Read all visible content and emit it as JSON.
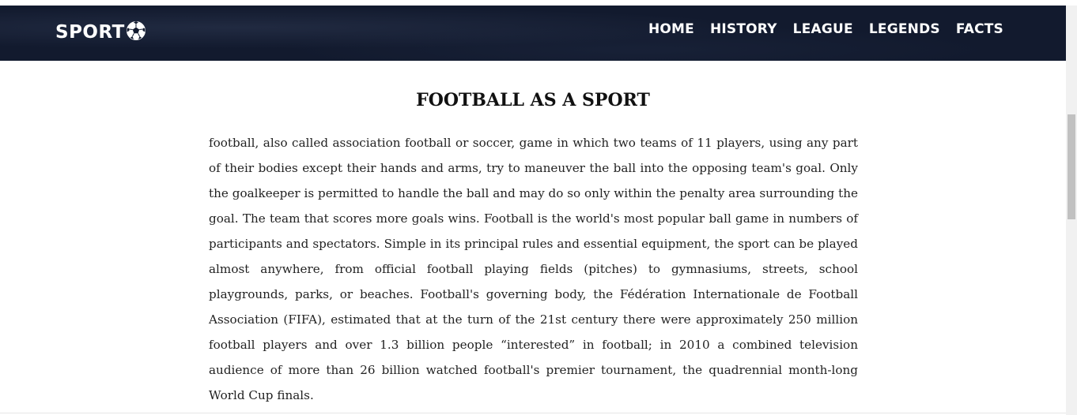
{
  "header": {
    "logo_text": "SPORT",
    "logo_icon": "soccer-ball-icon",
    "background_color": "#121a2e"
  },
  "nav": {
    "items": [
      {
        "label": "HOME"
      },
      {
        "label": "HISTORY"
      },
      {
        "label": "LEAGUE"
      },
      {
        "label": "LEGENDS"
      },
      {
        "label": "FACTS"
      }
    ]
  },
  "main": {
    "title": "FOOTBALL AS A SPORT",
    "paragraph": "football, also called association football or soccer, game in which two teams of 11 players, using any part of their bodies except their hands and arms, try to maneuver the ball into the opposing team's goal. Only the goalkeeper is permitted to handle the ball and may do so only within the penalty area surrounding the goal. The team that scores more goals wins. Football is the world's most popular ball game in numbers of participants and spectators. Simple in its principal rules and essential equipment, the sport can be played almost anywhere, from official football playing fields (pitches) to gymnasiums, streets, school playgrounds, parks, or beaches. Football's governing body, the Fédération Internationale de Football Association (FIFA), estimated that at the turn of the 21st century there were approximately 250 million football players and over 1.3 billion people “interested” in football; in 2010 a combined television audience of more than 26 billion watched football's premier tournament, the quadrennial month-long World Cup finals."
  }
}
